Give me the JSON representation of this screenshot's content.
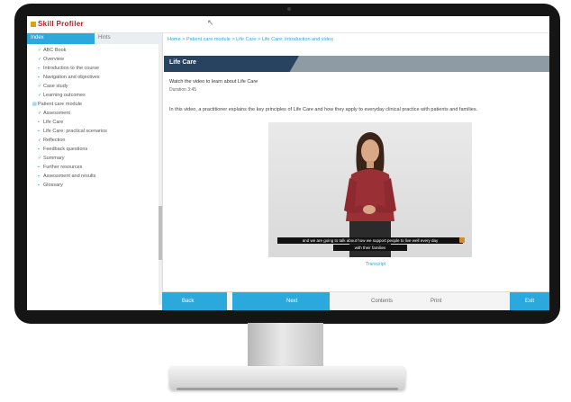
{
  "app": {
    "logo_text": "Skill Profiler",
    "brand_color": "#a3252b",
    "accent_color": "#2ba8dc"
  },
  "sidebar": {
    "tabs": [
      {
        "label": "Index",
        "active": true
      },
      {
        "label": "Hints",
        "active": false
      }
    ],
    "items": [
      {
        "label": "ABC Book",
        "icon": "check-icon"
      },
      {
        "label": "Overview",
        "icon": "check-icon"
      },
      {
        "label": "Introduction to the course",
        "icon": "page-icon"
      },
      {
        "label": "Navigation and objectives",
        "icon": "page-icon"
      },
      {
        "label": "Case study",
        "icon": "check-icon"
      },
      {
        "label": "Learning outcomes",
        "icon": "check-icon"
      },
      {
        "label": "Patient care module",
        "icon": "folder-icon"
      },
      {
        "label": "Assessment",
        "icon": "check-icon"
      },
      {
        "label": "Life Care",
        "icon": "page-icon"
      },
      {
        "label": "Life Care: practical scenarios",
        "icon": "page-icon"
      },
      {
        "label": "Reflection",
        "icon": "check-icon"
      },
      {
        "label": "Feedback questions",
        "icon": "page-icon"
      },
      {
        "label": "Summary",
        "icon": "check-icon"
      },
      {
        "label": "Further resources",
        "icon": "page-icon"
      },
      {
        "label": "Assessment and results",
        "icon": "page-icon"
      },
      {
        "label": "Glossary",
        "icon": "page-icon"
      }
    ]
  },
  "main": {
    "breadcrumb": "Home > Patient care module > Life Care > Life Care: introduction and video",
    "banner_title": "Life Care",
    "intro_line1": "Watch the video to learn about Life Care",
    "intro_line2": "Duration 3:45",
    "paragraph": "In this video, a practitioner explains the key principles of Life Care and how they apply to everyday clinical practice with patients and families.",
    "video": {
      "caption_line1": "and we are going to talk about how we support people to live well every day",
      "caption_line2": "with their families"
    },
    "under_video": "Transcript"
  },
  "footer": {
    "back_label": "Back",
    "forward_label": "Next",
    "item1": "Contents",
    "item2": "Print",
    "end_label": "Exit"
  }
}
